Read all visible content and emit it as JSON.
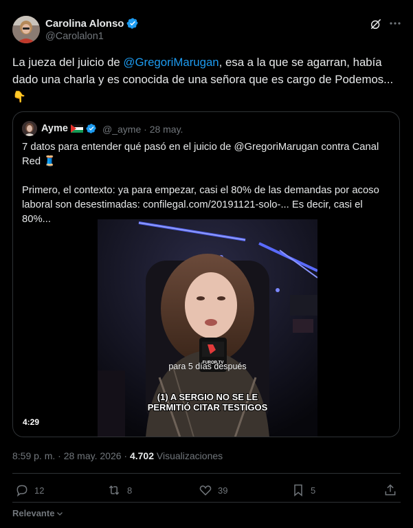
{
  "author": {
    "name": "Carolina Alonso",
    "handle": "@Carolalon1"
  },
  "tweet": {
    "text_before": "La jueza del juicio de ",
    "mention": "@GregoriMarugan",
    "text_after": ", esa a la que se agarran, había dado una charla y es conocida de una señora que es cargo de Podemos...",
    "emoji": "👇"
  },
  "quote": {
    "name": "Ayme",
    "handle": "@_ayme",
    "date": "28 may.",
    "separator": "·",
    "para1": "7 datos para entender qué pasó en el juicio de @GregoriMarugan contra Canal Red 🧵",
    "para2": "Primero, el contexto: ya para empezar, casi el 80% de las demandas por acoso laboral son desestimadas: confilegal.com/20191121-solo-... Es decir, casi el 80%...",
    "video": {
      "duration": "4:29",
      "caption_top": "para 5 días después",
      "caption_bottom_1": "(1) A SERGIO NO SE LE",
      "caption_bottom_2": "PERMITIÓ CITAR TESTIGOS",
      "mic_label": "FUROR.TV"
    }
  },
  "meta": {
    "time": "8:59 p. m.",
    "sep": "·",
    "date": "28 may. 2026",
    "views_count": "4.702",
    "views_label": "Visualizaciones"
  },
  "actions": {
    "replies": "12",
    "reposts": "8",
    "likes": "39",
    "bookmarks": "5"
  },
  "relevant_label": "Relevante",
  "colors": {
    "accent": "#1d9bf0",
    "text": "#e7e9ea",
    "muted": "#71767b",
    "border": "#2f3336"
  }
}
